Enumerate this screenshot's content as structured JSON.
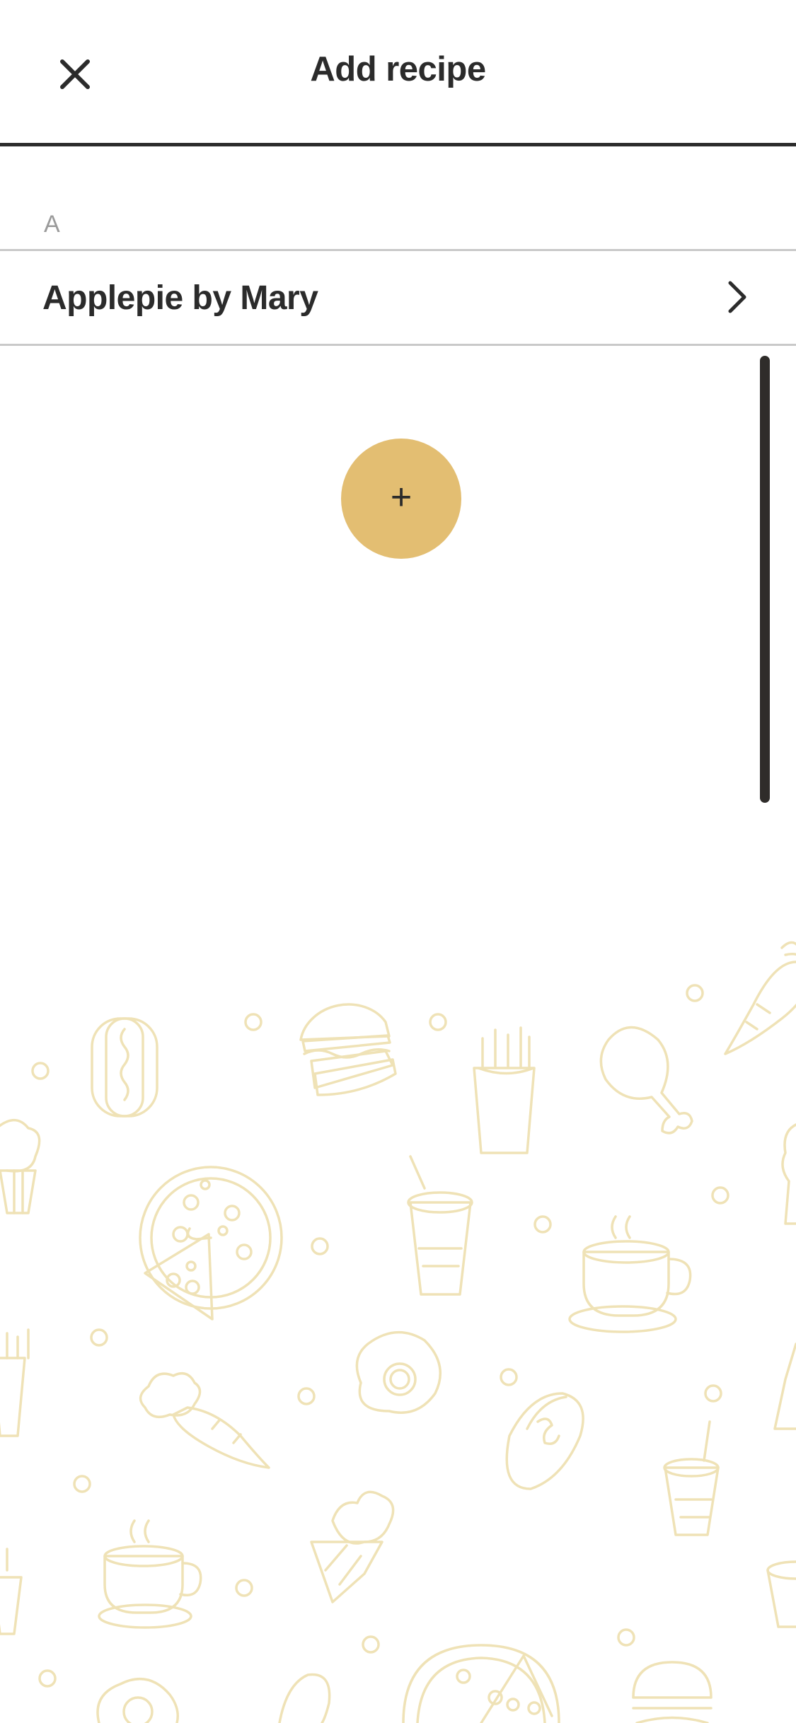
{
  "header": {
    "title": "Add recipe",
    "close_icon": "close-icon"
  },
  "section": {
    "letter": "A"
  },
  "recipes": [
    {
      "name": "Applepie by Mary",
      "icon": "chevron-right-icon"
    }
  ],
  "add_button": {
    "label": "+",
    "color": "#e3be72"
  },
  "background": {
    "pattern_color": "#efe2b6",
    "pattern_icons": [
      "hotdog-icon",
      "burger-icon",
      "fries-icon",
      "chicken-leg-icon",
      "carrot-icon",
      "cupcake-icon",
      "pizza-icon",
      "soda-cup-icon",
      "coffee-cup-icon",
      "fried-egg-icon"
    ]
  }
}
